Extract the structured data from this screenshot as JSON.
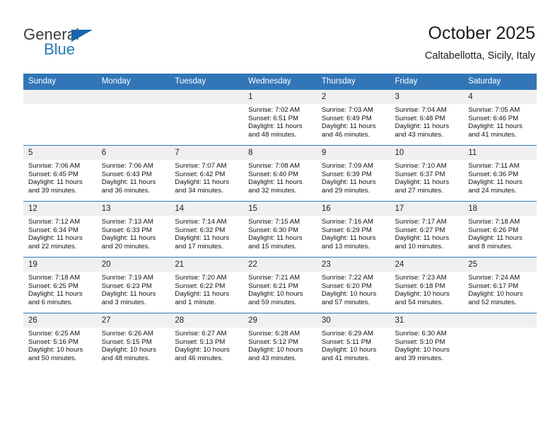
{
  "brand": {
    "word_top": "General",
    "word_bottom": "Blue",
    "accent_color": "#1666ad",
    "blue_text_color": "#1f7ac4"
  },
  "header": {
    "title": "October 2025",
    "subtitle": "Caltabellotta, Sicily, Italy",
    "header_bg_color": "#3276b8",
    "daynum_bg_color": "#f0f0f0"
  },
  "weekdays": [
    "Sunday",
    "Monday",
    "Tuesday",
    "Wednesday",
    "Thursday",
    "Friday",
    "Saturday"
  ],
  "weeks": [
    [
      {
        "day": "",
        "lines": []
      },
      {
        "day": "",
        "lines": []
      },
      {
        "day": "",
        "lines": []
      },
      {
        "day": "1",
        "lines": [
          "Sunrise: 7:02 AM",
          "Sunset: 6:51 PM",
          "Daylight: 11 hours",
          "and 48 minutes."
        ]
      },
      {
        "day": "2",
        "lines": [
          "Sunrise: 7:03 AM",
          "Sunset: 6:49 PM",
          "Daylight: 11 hours",
          "and 46 minutes."
        ]
      },
      {
        "day": "3",
        "lines": [
          "Sunrise: 7:04 AM",
          "Sunset: 6:48 PM",
          "Daylight: 11 hours",
          "and 43 minutes."
        ]
      },
      {
        "day": "4",
        "lines": [
          "Sunrise: 7:05 AM",
          "Sunset: 6:46 PM",
          "Daylight: 11 hours",
          "and 41 minutes."
        ]
      }
    ],
    [
      {
        "day": "5",
        "lines": [
          "Sunrise: 7:06 AM",
          "Sunset: 6:45 PM",
          "Daylight: 11 hours",
          "and 39 minutes."
        ]
      },
      {
        "day": "6",
        "lines": [
          "Sunrise: 7:06 AM",
          "Sunset: 6:43 PM",
          "Daylight: 11 hours",
          "and 36 minutes."
        ]
      },
      {
        "day": "7",
        "lines": [
          "Sunrise: 7:07 AM",
          "Sunset: 6:42 PM",
          "Daylight: 11 hours",
          "and 34 minutes."
        ]
      },
      {
        "day": "8",
        "lines": [
          "Sunrise: 7:08 AM",
          "Sunset: 6:40 PM",
          "Daylight: 11 hours",
          "and 32 minutes."
        ]
      },
      {
        "day": "9",
        "lines": [
          "Sunrise: 7:09 AM",
          "Sunset: 6:39 PM",
          "Daylight: 11 hours",
          "and 29 minutes."
        ]
      },
      {
        "day": "10",
        "lines": [
          "Sunrise: 7:10 AM",
          "Sunset: 6:37 PM",
          "Daylight: 11 hours",
          "and 27 minutes."
        ]
      },
      {
        "day": "11",
        "lines": [
          "Sunrise: 7:11 AM",
          "Sunset: 6:36 PM",
          "Daylight: 11 hours",
          "and 24 minutes."
        ]
      }
    ],
    [
      {
        "day": "12",
        "lines": [
          "Sunrise: 7:12 AM",
          "Sunset: 6:34 PM",
          "Daylight: 11 hours",
          "and 22 minutes."
        ]
      },
      {
        "day": "13",
        "lines": [
          "Sunrise: 7:13 AM",
          "Sunset: 6:33 PM",
          "Daylight: 11 hours",
          "and 20 minutes."
        ]
      },
      {
        "day": "14",
        "lines": [
          "Sunrise: 7:14 AM",
          "Sunset: 6:32 PM",
          "Daylight: 11 hours",
          "and 17 minutes."
        ]
      },
      {
        "day": "15",
        "lines": [
          "Sunrise: 7:15 AM",
          "Sunset: 6:30 PM",
          "Daylight: 11 hours",
          "and 15 minutes."
        ]
      },
      {
        "day": "16",
        "lines": [
          "Sunrise: 7:16 AM",
          "Sunset: 6:29 PM",
          "Daylight: 11 hours",
          "and 13 minutes."
        ]
      },
      {
        "day": "17",
        "lines": [
          "Sunrise: 7:17 AM",
          "Sunset: 6:27 PM",
          "Daylight: 11 hours",
          "and 10 minutes."
        ]
      },
      {
        "day": "18",
        "lines": [
          "Sunrise: 7:18 AM",
          "Sunset: 6:26 PM",
          "Daylight: 11 hours",
          "and 8 minutes."
        ]
      }
    ],
    [
      {
        "day": "19",
        "lines": [
          "Sunrise: 7:18 AM",
          "Sunset: 6:25 PM",
          "Daylight: 11 hours",
          "and 6 minutes."
        ]
      },
      {
        "day": "20",
        "lines": [
          "Sunrise: 7:19 AM",
          "Sunset: 6:23 PM",
          "Daylight: 11 hours",
          "and 3 minutes."
        ]
      },
      {
        "day": "21",
        "lines": [
          "Sunrise: 7:20 AM",
          "Sunset: 6:22 PM",
          "Daylight: 11 hours",
          "and 1 minute."
        ]
      },
      {
        "day": "22",
        "lines": [
          "Sunrise: 7:21 AM",
          "Sunset: 6:21 PM",
          "Daylight: 10 hours",
          "and 59 minutes."
        ]
      },
      {
        "day": "23",
        "lines": [
          "Sunrise: 7:22 AM",
          "Sunset: 6:20 PM",
          "Daylight: 10 hours",
          "and 57 minutes."
        ]
      },
      {
        "day": "24",
        "lines": [
          "Sunrise: 7:23 AM",
          "Sunset: 6:18 PM",
          "Daylight: 10 hours",
          "and 54 minutes."
        ]
      },
      {
        "day": "25",
        "lines": [
          "Sunrise: 7:24 AM",
          "Sunset: 6:17 PM",
          "Daylight: 10 hours",
          "and 52 minutes."
        ]
      }
    ],
    [
      {
        "day": "26",
        "lines": [
          "Sunrise: 6:25 AM",
          "Sunset: 5:16 PM",
          "Daylight: 10 hours",
          "and 50 minutes."
        ]
      },
      {
        "day": "27",
        "lines": [
          "Sunrise: 6:26 AM",
          "Sunset: 5:15 PM",
          "Daylight: 10 hours",
          "and 48 minutes."
        ]
      },
      {
        "day": "28",
        "lines": [
          "Sunrise: 6:27 AM",
          "Sunset: 5:13 PM",
          "Daylight: 10 hours",
          "and 46 minutes."
        ]
      },
      {
        "day": "29",
        "lines": [
          "Sunrise: 6:28 AM",
          "Sunset: 5:12 PM",
          "Daylight: 10 hours",
          "and 43 minutes."
        ]
      },
      {
        "day": "30",
        "lines": [
          "Sunrise: 6:29 AM",
          "Sunset: 5:11 PM",
          "Daylight: 10 hours",
          "and 41 minutes."
        ]
      },
      {
        "day": "31",
        "lines": [
          "Sunrise: 6:30 AM",
          "Sunset: 5:10 PM",
          "Daylight: 10 hours",
          "and 39 minutes."
        ]
      },
      {
        "day": "",
        "lines": []
      }
    ]
  ]
}
